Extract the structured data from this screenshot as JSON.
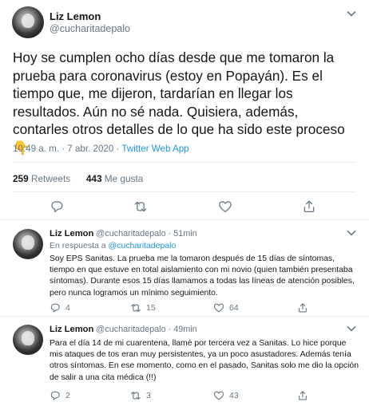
{
  "main_tweet": {
    "name": "Liz Lemon",
    "handle": "@cucharitadepalo",
    "text": "Hoy se cumplen ocho días desde que me tomaron la prueba para coronavirus (estoy en Popayán). Es el tiempo que, me dijeron, tardarían en llegar los resultados. Aún no sé nada. Quisiera, además, contarles otros detalles de lo que ha sido este proceso",
    "emoji": "👇",
    "timestamp": "10:49 a. m. · 7 abr. 2020 · ",
    "source": "Twitter Web App",
    "retweets_count": "259",
    "retweets_label": "Retweets",
    "likes_count": "443",
    "likes_label": "Me gusta"
  },
  "replies": [
    {
      "name": "Liz Lemon",
      "handle": "@cucharitadepalo",
      "time": "· 51min",
      "in_reply_prefix": "En respuesta a ",
      "in_reply_mention": "@cucharitadepalo",
      "text": "Soy EPS Sanitas. La prueba me la tomaron después de 15 días de síntomas, tiempo en que estuve en total aislamiento con mi novio (quien también presentaba síntomas). Durante esos 15 días llamamos a todas las líneas de atención posibles, pero nunca logramos un mínimo seguimiento.",
      "replies": "4",
      "retweets": "15",
      "likes": "64"
    },
    {
      "name": "Liz Lemon",
      "handle": "@cucharitadepalo",
      "time": "· 49min",
      "text": "Para el día 14 de mi cuarentena, llamé por tercera vez a Sanitas. Lo hice porque mis ataques de tos eran muy persistentes, ya un poco asustadores. Además tenía otros síntomas. En ese momento, como en el pasado, Sanitas solo me dio la opción de salir a una cita médica (!!)",
      "replies": "2",
      "retweets": "3",
      "likes": "43"
    }
  ],
  "icons": [
    "reply-icon",
    "retweet-icon",
    "like-icon",
    "share-icon",
    "chevron-down-icon"
  ],
  "colors": {
    "accent": "#1b95e0",
    "muted": "#657786",
    "text": "#14171a",
    "border": "#e6ecf0"
  }
}
